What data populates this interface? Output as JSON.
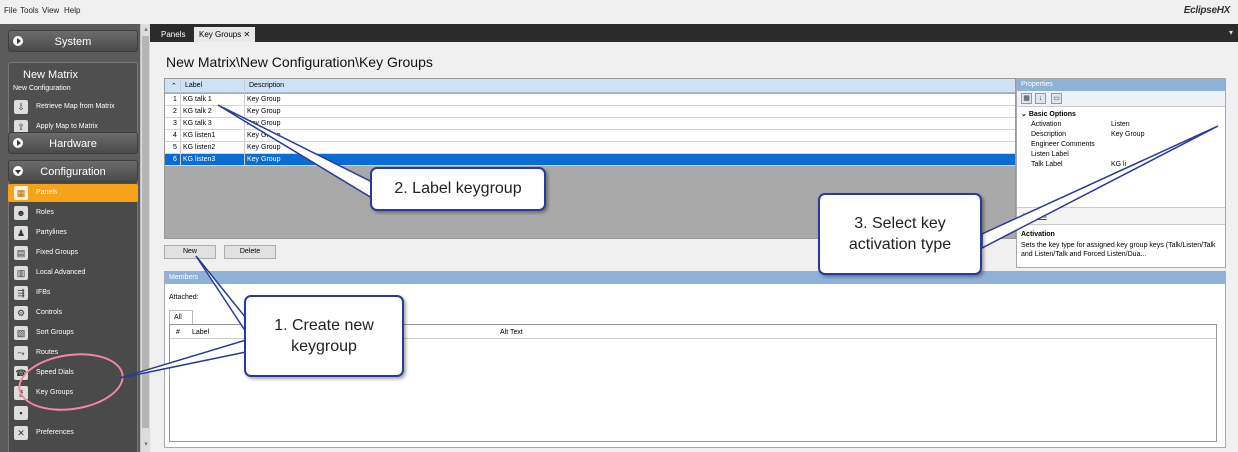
{
  "menu": {
    "items": [
      "File",
      "Tools",
      "View",
      "Help"
    ],
    "brand": "EclipseHX"
  },
  "sidebar": {
    "system_label": "System",
    "matrix_title": "New Matrix",
    "matrix_subtitle": "New Configuration",
    "retrieve_label": "Retrieve Map from Matrix",
    "apply_label": "Apply Map to Matrix",
    "hardware_label": "Hardware",
    "configuration_label": "Configuration",
    "items": [
      "Panels",
      "Roles",
      "Partylines",
      "Fixed Groups",
      "Local Advanced",
      "IFBs",
      "Controls",
      "Sort Groups",
      "Routes",
      "Speed Dials",
      "Key Groups",
      "",
      "Preferences"
    ]
  },
  "tabs": [
    "Panels",
    "Key Groups"
  ],
  "page_title": "New Matrix\\New Configuration\\Key Groups",
  "grid": {
    "columns": [
      "Label",
      "Description"
    ],
    "rows": [
      {
        "num": "1",
        "label": "KG talk 1",
        "desc": "Key Group"
      },
      {
        "num": "2",
        "label": "KG talk 2",
        "desc": "Key Group"
      },
      {
        "num": "3",
        "label": "KG talk 3",
        "desc": "Key Group"
      },
      {
        "num": "4",
        "label": "KG listen1",
        "desc": "Key Group"
      },
      {
        "num": "5",
        "label": "KG listen2",
        "desc": "Key Group"
      },
      {
        "num": "6",
        "label": "KG listen3",
        "desc": "Key Group"
      }
    ],
    "selected_row": 6
  },
  "buttons": {
    "new": "New",
    "delete": "Delete"
  },
  "properties": {
    "header": "Properties",
    "category": "Basic Options",
    "rows": [
      {
        "name": "Activation",
        "value": "Listen"
      },
      {
        "name": "Description",
        "value": "Key Group"
      },
      {
        "name": "Engineer Comments",
        "value": ""
      },
      {
        "name": "Listen Label",
        "value": ""
      },
      {
        "name": "Talk Label",
        "value": "KG li"
      }
    ],
    "usages_link": "Usages",
    "desc_title": "Activation",
    "desc_text": "Sets the key type for assigned key group keys (Talk/Listen/Talk and Listen/Talk and Forced Listen/Dua..."
  },
  "members": {
    "header": "Members",
    "attached_label": "Attached:",
    "tab_all": "All",
    "columns": [
      "#",
      "Label",
      "Alt Text"
    ]
  },
  "callouts": {
    "c1": [
      "1. Create new",
      "keygroup"
    ],
    "c2": "2. Label keygroup",
    "c3": [
      "3. Select key",
      "activation type"
    ]
  },
  "colors": {
    "accent": "#f7a21b",
    "selection": "#0a6dd3",
    "callout_border": "#2b3a98",
    "circle": "#f08aa0"
  }
}
